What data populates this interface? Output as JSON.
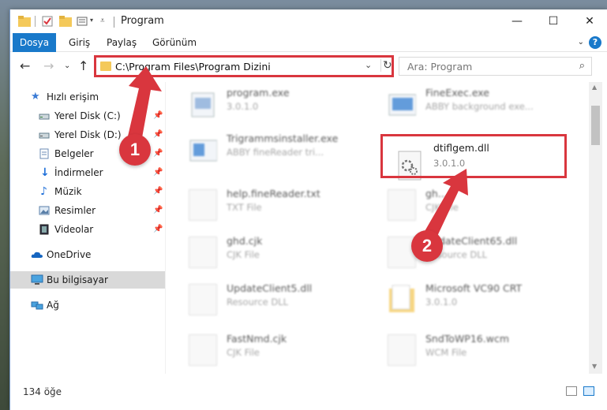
{
  "window": {
    "title": "Program"
  },
  "ribbon": {
    "tabs": [
      "Dosya",
      "Giriş",
      "Paylaş",
      "Görünüm"
    ],
    "active_tab": "Dosya"
  },
  "address": {
    "path": "C:\\Program Files\\Program Dizini"
  },
  "search": {
    "placeholder": "Ara: Program"
  },
  "sidebar": {
    "items": [
      {
        "label": "Hızlı erişim",
        "icon": "star-icon"
      },
      {
        "label": "Yerel Disk (C:)",
        "icon": "drive-icon"
      },
      {
        "label": "Yerel Disk (D:)",
        "icon": "drive-icon"
      },
      {
        "label": "Belgeler",
        "icon": "documents-icon"
      },
      {
        "label": "İndirmeler",
        "icon": "download-icon"
      },
      {
        "label": "Müzik",
        "icon": "music-icon"
      },
      {
        "label": "Resimler",
        "icon": "pictures-icon"
      },
      {
        "label": "Videolar",
        "icon": "video-icon"
      },
      {
        "label": "OneDrive",
        "icon": "cloud-icon"
      },
      {
        "label": "Bu bilgisayar",
        "icon": "computer-icon"
      },
      {
        "label": "Ağ",
        "icon": "network-icon"
      }
    ]
  },
  "files": [
    {
      "name": "program.exe",
      "sub": "3.0.1.0"
    },
    {
      "name": "FineExec.exe",
      "sub": "ABBY background exe..."
    },
    {
      "name": "Trigrammsinstaller.exe",
      "sub": "ABBY fineReader tri..."
    },
    {
      "name": "dtiflgem.dll",
      "sub": "3.0.1.0"
    },
    {
      "name": "help.fineReader.txt",
      "sub": "TXT File"
    },
    {
      "name": "gh...",
      "sub": "CJK File"
    },
    {
      "name": "ghd.cjk",
      "sub": "CJK File"
    },
    {
      "name": "UpdateClient65.dll",
      "sub": "Resource DLL"
    },
    {
      "name": "UpdateClient5.dll",
      "sub": "Resource DLL"
    },
    {
      "name": "Microsoft VC90 CRT",
      "sub": "3.0.1.0"
    },
    {
      "name": "FastNmd.cjk",
      "sub": "CJK File"
    },
    {
      "name": "SndToWP16.wcm",
      "sub": "WCM File"
    }
  ],
  "status": {
    "count": "134 öğe"
  },
  "callouts": {
    "one": "1",
    "two": "2"
  },
  "colors": {
    "accent": "#1979ca",
    "highlight": "#d9363e"
  }
}
